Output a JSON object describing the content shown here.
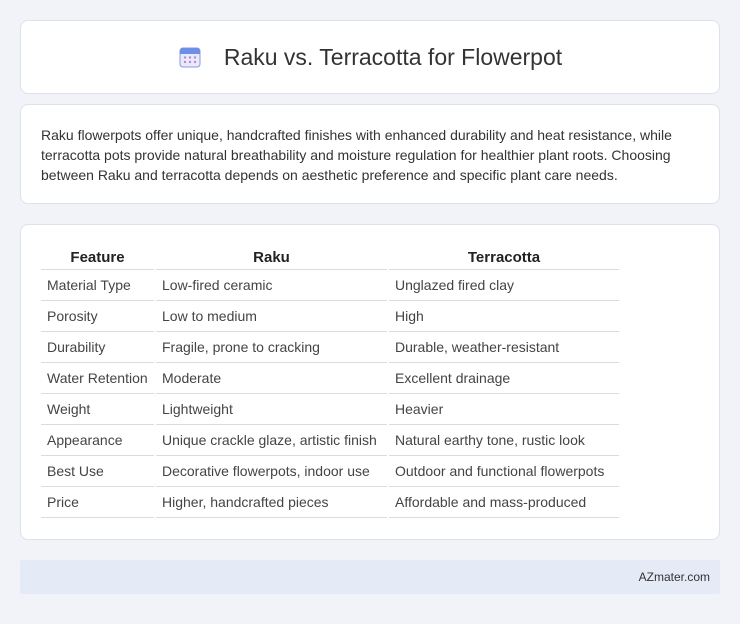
{
  "header": {
    "title": "Raku vs. Terracotta for Flowerpot",
    "icon": "calendar-icon"
  },
  "intro": {
    "text": "Raku flowerpots offer unique, handcrafted finishes with enhanced durability and heat resistance, while terracotta pots provide natural breathability and moisture regulation for healthier plant roots. Choosing between Raku and terracotta depends on aesthetic preference and specific plant care needs."
  },
  "table": {
    "headers": [
      "Feature",
      "Raku",
      "Terracotta"
    ],
    "rows": [
      [
        "Material Type",
        "Low-fired ceramic",
        "Unglazed fired clay"
      ],
      [
        "Porosity",
        "Low to medium",
        "High"
      ],
      [
        "Durability",
        "Fragile, prone to cracking",
        "Durable, weather-resistant"
      ],
      [
        "Water Retention",
        "Moderate",
        "Excellent drainage"
      ],
      [
        "Weight",
        "Lightweight",
        "Heavier"
      ],
      [
        "Appearance",
        "Unique crackle glaze, artistic finish",
        "Natural earthy tone, rustic look"
      ],
      [
        "Best Use",
        "Decorative flowerpots, indoor use",
        "Outdoor and functional flowerpots"
      ],
      [
        "Price",
        "Higher, handcrafted pieces",
        "Affordable and mass-produced"
      ]
    ]
  },
  "footer": {
    "text": "AZmater.com"
  },
  "colors": {
    "background": "#f1f3f8",
    "card": "#ffffff",
    "footer": "#e4eaf6",
    "icon_accent": "#7b7fe0"
  }
}
